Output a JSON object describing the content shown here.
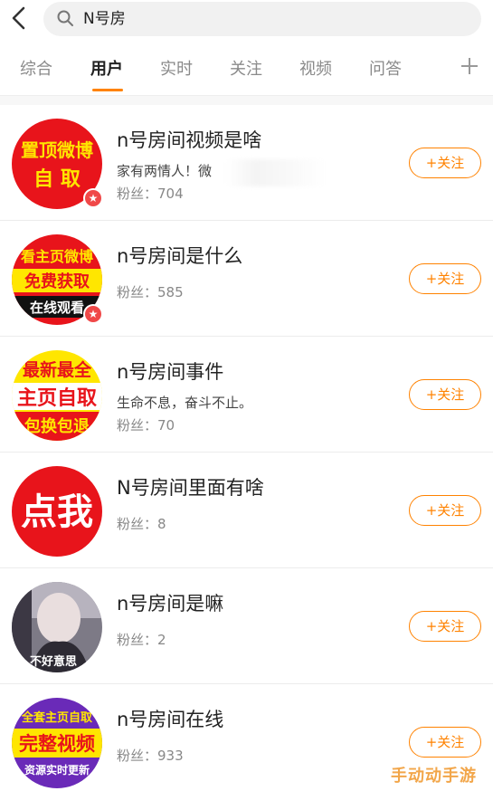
{
  "search": {
    "query": "N号房"
  },
  "tabs": [
    {
      "label": "综合"
    },
    {
      "label": "用户"
    },
    {
      "label": "实时"
    },
    {
      "label": "关注"
    },
    {
      "label": "视频"
    },
    {
      "label": "问答"
    }
  ],
  "users": [
    {
      "name": "n号房间视频是啥",
      "desc": "家有两情人！微",
      "fans_label": "粉丝：704",
      "avatar_text": [
        "置顶微博",
        "自 取"
      ],
      "vip": true,
      "follow_label": "+关注"
    },
    {
      "name": "n号房间是什么",
      "desc": "",
      "fans_label": "粉丝：585",
      "avatar_text": [
        "看主页微博",
        "免费获取",
        "在线观看"
      ],
      "vip": true,
      "follow_label": "+关注"
    },
    {
      "name": "n号房间事件",
      "desc": "生命不息，奋斗不止。",
      "fans_label": "粉丝：70",
      "avatar_text": [
        "最新最全",
        "主页自取",
        "包换包退"
      ],
      "vip": false,
      "follow_label": "+关注"
    },
    {
      "name": "N号房间里面有啥",
      "desc": "",
      "fans_label": "粉丝：8",
      "avatar_text": [
        "点我"
      ],
      "vip": false,
      "follow_label": "+关注"
    },
    {
      "name": "n号房间是嘛",
      "desc": "",
      "fans_label": "粉丝：2",
      "avatar_text": [
        "不好意思"
      ],
      "vip": false,
      "follow_label": "+关注"
    },
    {
      "name": "n号房间在线",
      "desc": "",
      "fans_label": "粉丝：933",
      "avatar_text": [
        "全套主页自取",
        "完整视频",
        "资源实时更新"
      ],
      "vip": false,
      "follow_label": "+关注"
    }
  ],
  "watermark": "手动动手游",
  "colors": {
    "accent": "#ff8200",
    "avatar_red": "#e8141b",
    "avatar_yellow": "#ffe600"
  }
}
